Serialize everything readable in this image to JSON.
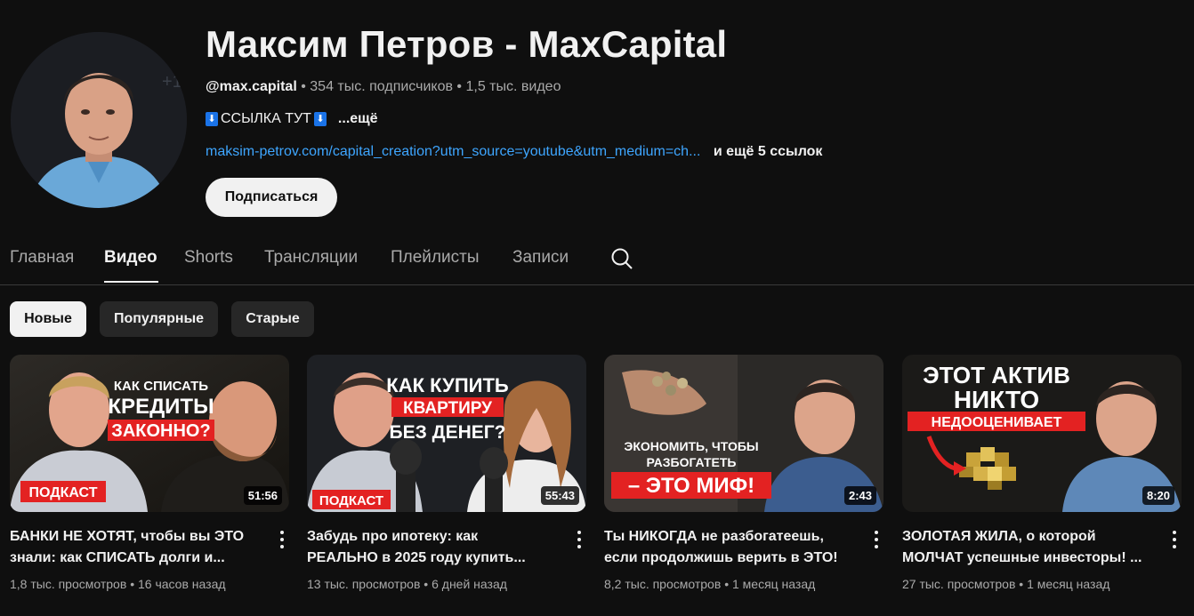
{
  "channel": {
    "title": "Максим Петров - MaxCapital",
    "handle": "@max.capital",
    "subscribers": "354 тыс. подписчиков",
    "videos": "1,5 тыс. видео",
    "desc_text": "ССЫЛКА ТУТ",
    "desc_more": "...ещё",
    "link": "maksim-petrov.com/capital_creation?utm_source=youtube&utm_medium=ch...",
    "more_links": "и ещё 5 ссылок",
    "subscribe_label": "Подписаться"
  },
  "tabs": [
    {
      "label": "Главная"
    },
    {
      "label": "Видео"
    },
    {
      "label": "Shorts"
    },
    {
      "label": "Трансляции"
    },
    {
      "label": "Плейлисты"
    },
    {
      "label": "Записи"
    }
  ],
  "active_tab": "Видео",
  "chips": [
    {
      "label": "Новые"
    },
    {
      "label": "Популярные"
    },
    {
      "label": "Старые"
    }
  ],
  "videos": [
    {
      "title_line1": "БАНКИ НЕ ХОТЯТ, чтобы вы ЭТО",
      "title_line2": "знали: как СПИСАТЬ долги и...",
      "views": "1,8 тыс. просмотров",
      "age": "16 часов назад",
      "duration": "51:56",
      "thumb_line1": "КАК СПИСАТЬ",
      "thumb_line2": "КРЕДИТЫ",
      "thumb_line3": "ЗАКОННО?",
      "thumb_badge": "ПОДКАСТ"
    },
    {
      "title_line1": "Забудь про ипотеку: как",
      "title_line2": "РЕАЛЬНО в 2025 году купить...",
      "views": "13 тыс. просмотров",
      "age": "6 дней назад",
      "duration": "55:43",
      "thumb_line1": "КАК КУПИТЬ",
      "thumb_line2": "КВАРТИРУ",
      "thumb_line3": "БЕЗ ДЕНЕГ?",
      "thumb_badge": "ПОДКАСТ"
    },
    {
      "title_line1": "Ты НИКОГДА не разбогатеешь,",
      "title_line2": "если продолжишь верить в ЭТО!",
      "views": "8,2 тыс. просмотров",
      "age": "1 месяц назад",
      "duration": "2:43",
      "thumb_line1": "ЭКОНОМИТЬ, ЧТОБЫ",
      "thumb_line2": "РАЗБОГАТЕТЬ",
      "thumb_line3": "– ЭТО МИФ!"
    },
    {
      "title_line1": "ЗОЛОТАЯ ЖИЛА, о которой",
      "title_line2": "МОЛЧАТ успешные инвесторы! ...",
      "views": "27 тыс. просмотров",
      "age": "1 месяц назад",
      "duration": "8:20",
      "thumb_line1": "ЭТОТ АКТИВ",
      "thumb_line2": "НИКТО",
      "thumb_line3": "НЕДООЦЕНИВАЕТ"
    }
  ],
  "dot_separator": "•",
  "arrow_glyph": "⬇"
}
